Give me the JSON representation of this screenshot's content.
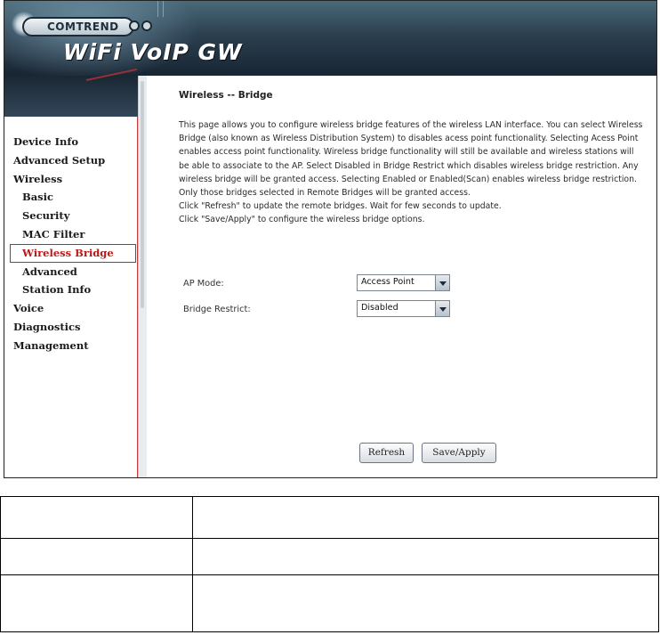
{
  "banner": {
    "brand": "COMTREND",
    "product": "WiFi VoIP GW"
  },
  "sidebar": {
    "items": [
      {
        "label": "Device Info",
        "level": 1
      },
      {
        "label": "Advanced Setup",
        "level": 1
      },
      {
        "label": "Wireless",
        "level": 1
      },
      {
        "label": "Basic",
        "level": 2
      },
      {
        "label": "Security",
        "level": 2
      },
      {
        "label": "MAC Filter",
        "level": 2
      },
      {
        "label": "Wireless Bridge",
        "level": 2,
        "active": true
      },
      {
        "label": "Advanced",
        "level": 2
      },
      {
        "label": "Station Info",
        "level": 2
      },
      {
        "label": "Voice",
        "level": 1
      },
      {
        "label": "Diagnostics",
        "level": 1
      },
      {
        "label": "Management",
        "level": 1
      }
    ]
  },
  "main": {
    "title": "Wireless -- Bridge",
    "description": [
      "This page allows you to configure wireless bridge features of the wireless LAN interface. You can select Wireless Bridge (also known as Wireless Distribution System) to disables acess point functionality. Selecting Acess Point enables access point functionality. Wireless bridge functionality will still be available and wireless stations will be able to associate to the AP. Select Disabled in Bridge Restrict which disables wireless bridge restriction. Any wireless bridge will be granted access. Selecting Enabled or Enabled(Scan) enables wireless bridge restriction. Only those bridges selected in Remote Bridges will be granted access.",
      "Click \"Refresh\" to update the remote bridges. Wait for few seconds to update.",
      "Click \"Save/Apply\" to configure the wireless bridge options."
    ],
    "ap_mode": {
      "label": "AP Mode:",
      "value": "Access Point"
    },
    "bridge_restrict": {
      "label": "Bridge Restrict:",
      "value": "Disabled"
    },
    "buttons": {
      "refresh": "Refresh",
      "save_apply": "Save/Apply"
    }
  },
  "table": {
    "rows": [
      [
        "",
        ""
      ],
      [
        "",
        ""
      ],
      [
        "",
        ""
      ]
    ]
  },
  "colors": {
    "active_nav": "#c01818",
    "sidebar_border": "#c23a3a",
    "banner_dark": "#182533"
  }
}
